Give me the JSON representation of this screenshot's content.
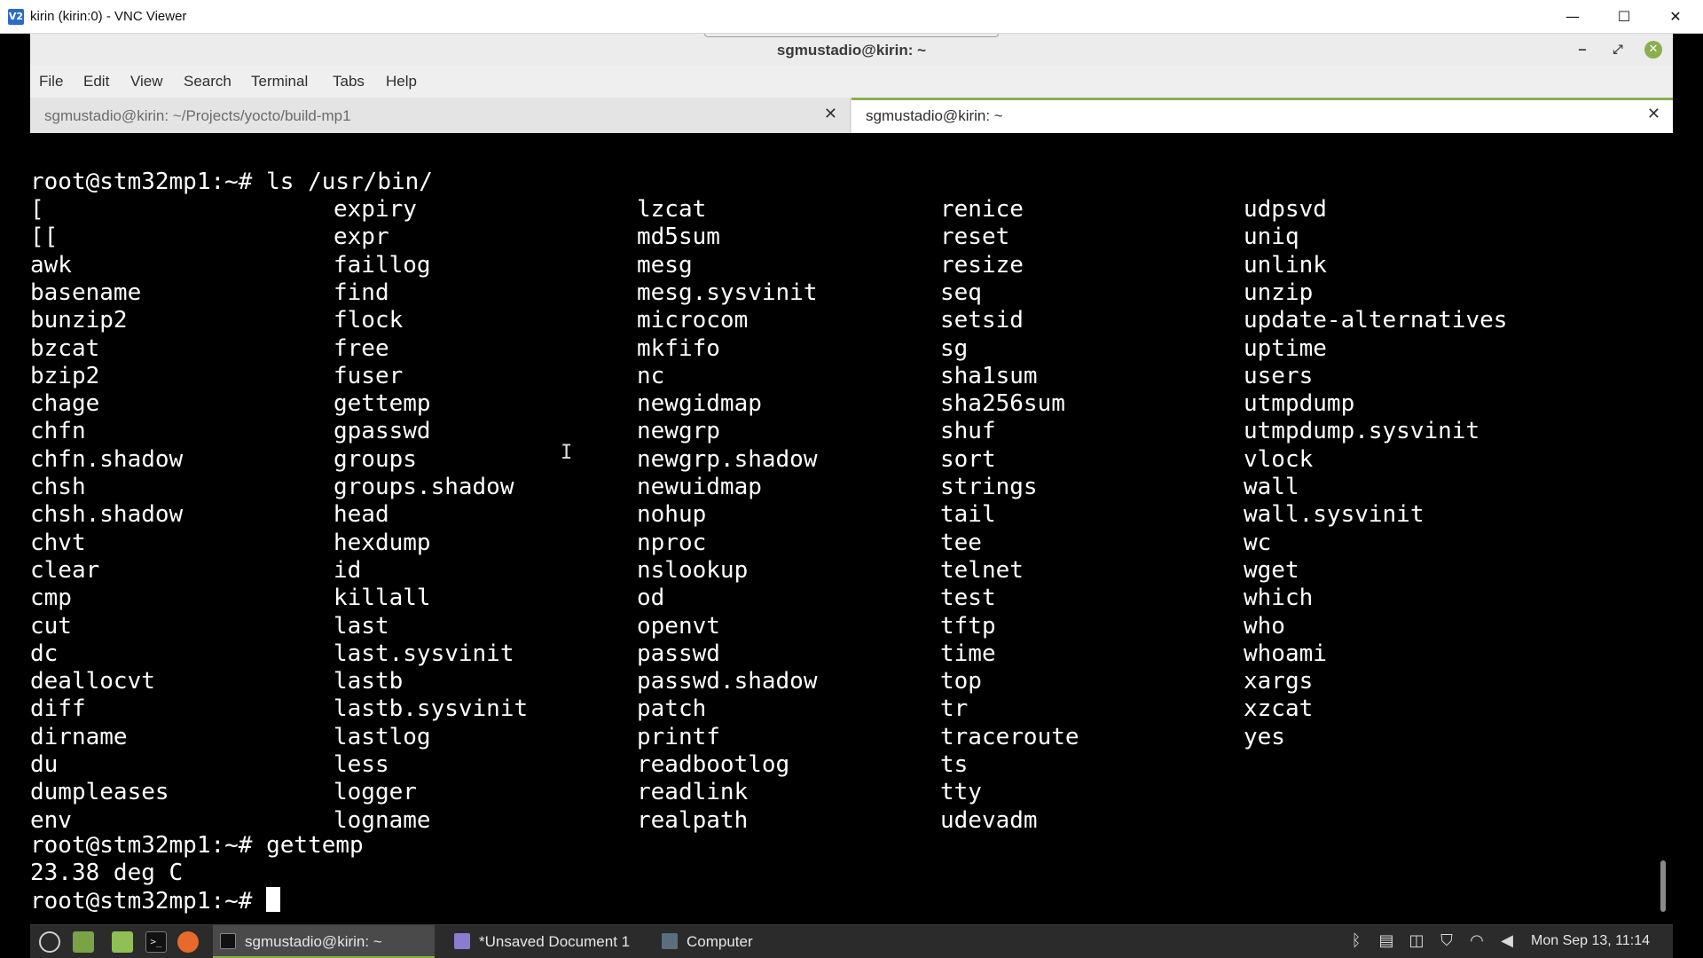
{
  "vnc_window": {
    "title": "kirin (kirin:0) - VNC Viewer",
    "icon_label": "V2",
    "minimize": "—",
    "maximize": "☐",
    "close": "✕"
  },
  "terminal_window": {
    "title": "sgmustadio@kirin: ~",
    "minimize": "‒",
    "maximize": "⤢",
    "close": "✕",
    "menu": [
      "File",
      "Edit",
      "View",
      "Search",
      "Terminal",
      "Tabs",
      "Help"
    ],
    "tabs": [
      {
        "label": "sgmustadio@kirin: ~/Projects/yocto/build-mp1",
        "active": false,
        "close": "✕"
      },
      {
        "label": "sgmustadio@kirin: ~",
        "active": true,
        "close": "✕"
      }
    ]
  },
  "terminal": {
    "command_1": "root@stm32mp1:~# ls /usr/bin/",
    "ls_columns": [
      [
        "[",
        "[[",
        "awk",
        "basename",
        "bunzip2",
        "bzcat",
        "bzip2",
        "chage",
        "chfn",
        "chfn.shadow",
        "chsh",
        "chsh.shadow",
        "chvt",
        "clear",
        "cmp",
        "cut",
        "dc",
        "deallocvt",
        "diff",
        "dirname",
        "du",
        "dumpleases",
        "env"
      ],
      [
        "expiry",
        "expr",
        "faillog",
        "find",
        "flock",
        "free",
        "fuser",
        "gettemp",
        "gpasswd",
        "groups",
        "groups.shadow",
        "head",
        "hexdump",
        "id",
        "killall",
        "last",
        "last.sysvinit",
        "lastb",
        "lastb.sysvinit",
        "lastlog",
        "less",
        "logger",
        "logname"
      ],
      [
        "lzcat",
        "md5sum",
        "mesg",
        "mesg.sysvinit",
        "microcom",
        "mkfifo",
        "nc",
        "newgidmap",
        "newgrp",
        "newgrp.shadow",
        "newuidmap",
        "nohup",
        "nproc",
        "nslookup",
        "od",
        "openvt",
        "passwd",
        "passwd.shadow",
        "patch",
        "printf",
        "readbootlog",
        "readlink",
        "realpath"
      ],
      [
        "renice",
        "reset",
        "resize",
        "seq",
        "setsid",
        "sg",
        "sha1sum",
        "sha256sum",
        "shuf",
        "sort",
        "strings",
        "tail",
        "tee",
        "telnet",
        "test",
        "tftp",
        "time",
        "top",
        "tr",
        "traceroute",
        "ts",
        "tty",
        "udevadm"
      ],
      [
        "udpsvd",
        "uniq",
        "unlink",
        "unzip",
        "update-alternatives",
        "uptime",
        "users",
        "utmpdump",
        "utmpdump.sysvinit",
        "vlock",
        "wall",
        "wall.sysvinit",
        "wc",
        "wget",
        "which",
        "who",
        "whoami",
        "xargs",
        "xzcat",
        "yes"
      ]
    ],
    "command_2": "root@stm32mp1:~# gettemp",
    "output_2": "23.38 deg C",
    "prompt": "root@stm32mp1:~# "
  },
  "taskbar": {
    "tasks": [
      {
        "label": "sgmustadio@kirin: ~",
        "active": true
      },
      {
        "label": "*Unsaved Document 1",
        "active": false
      },
      {
        "label": "Computer",
        "active": false
      }
    ],
    "tray_icons": [
      "bluetooth-icon",
      "clipboard-icon",
      "update-manager-icon",
      "shield-icon",
      "wifi-icon",
      "volume-icon"
    ],
    "clock": "Mon Sep 13, 11:14"
  }
}
